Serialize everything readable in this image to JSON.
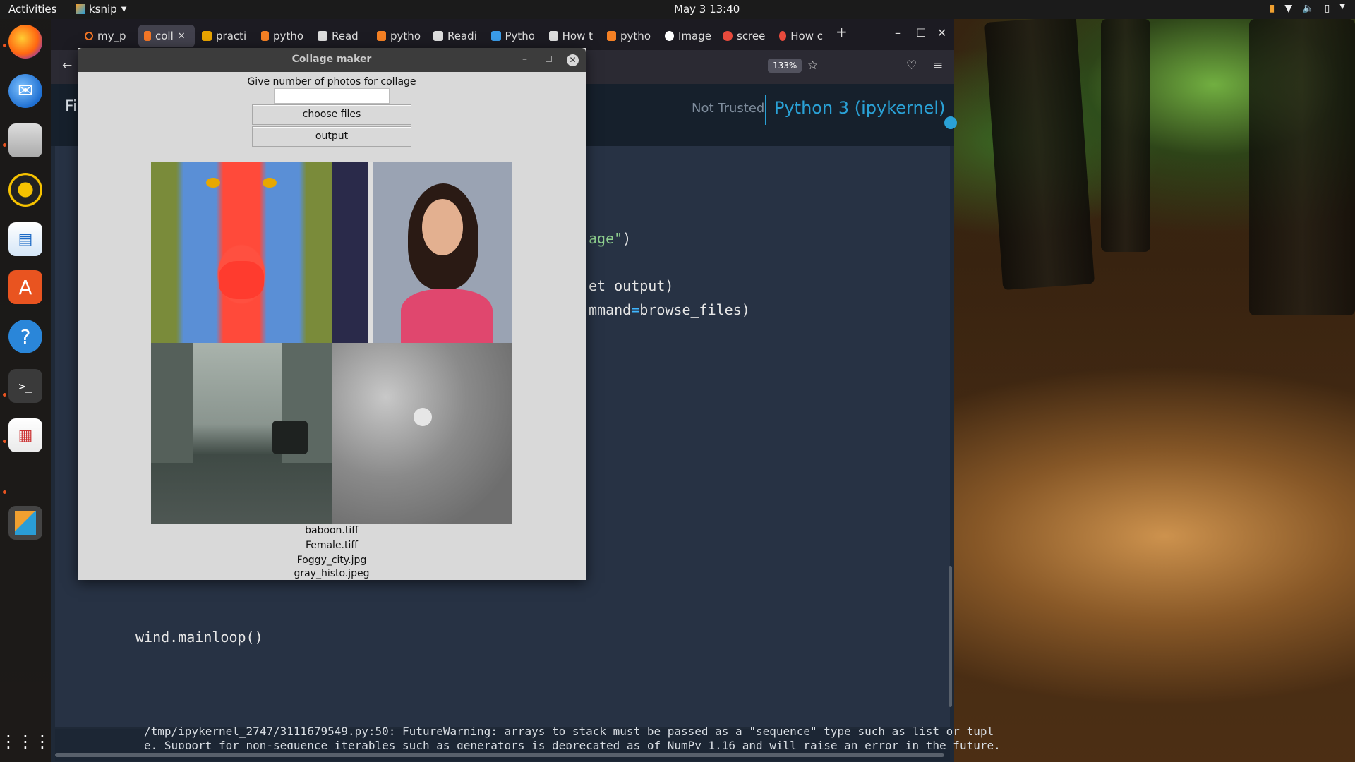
{
  "topbar": {
    "activities": "Activities",
    "app_name": "ksnip",
    "clock": "May 3  13:40"
  },
  "dock": {
    "items": [
      "firefox-icon",
      "thunderbird-icon",
      "files-icon",
      "rhythmbox-icon",
      "writer-icon",
      "software-icon",
      "help-icon",
      "terminal-icon",
      "document-viewer-icon",
      "ksnip-icon"
    ]
  },
  "browser": {
    "tabs": [
      {
        "label": "my_p",
        "color": "#f37626"
      },
      {
        "label": "coll",
        "color": "#f37626"
      },
      {
        "label": "practi",
        "color": "#e8a400"
      },
      {
        "label": "pytho",
        "color": "#f48024"
      },
      {
        "label": "Read",
        "color": "#dddddd"
      },
      {
        "label": "pytho",
        "color": "#f48024"
      },
      {
        "label": "Readi",
        "color": "#dddddd"
      },
      {
        "label": "Pytho",
        "color": "#3a9be8"
      },
      {
        "label": "How t",
        "color": "#dddddd"
      },
      {
        "label": "pytho",
        "color": "#f48024"
      },
      {
        "label": "Image",
        "color": "#ffffff"
      },
      {
        "label": "scree",
        "color": "#e84a3c"
      },
      {
        "label": "How c",
        "color": "#e84a3c"
      }
    ],
    "zoom": "133%",
    "notebook_header_left": "Fi",
    "not_trusted": "Not Trusted",
    "kernel": "Python 3 (ipykernel)",
    "code_lines": {
      "line1_str": "age\"",
      "line1_end": ")",
      "line2": "et_output)",
      "line3_a": "mmand",
      "line3_eq": "=",
      "line3_b": "browse_files)",
      "mainloop": "wind.mainloop()"
    },
    "warning_line1": "/tmp/ipykernel_2747/3111679549.py:50: FutureWarning: arrays to stack must be passed as a \"sequence\" type such as list or tupl",
    "warning_line2": "e. Support for non-sequence iterables such as generators is deprecated as of NumPy 1.16 and will raise an error in the future."
  },
  "collage_window": {
    "title": "Collage maker",
    "prompt": "Give number of photos for collage",
    "input_value": "",
    "choose_button": "choose files",
    "output_button": "output",
    "files": [
      "baboon.tiff",
      "Female.tiff",
      "Foggy_city.jpg",
      "gray_histo.jpeg"
    ]
  }
}
